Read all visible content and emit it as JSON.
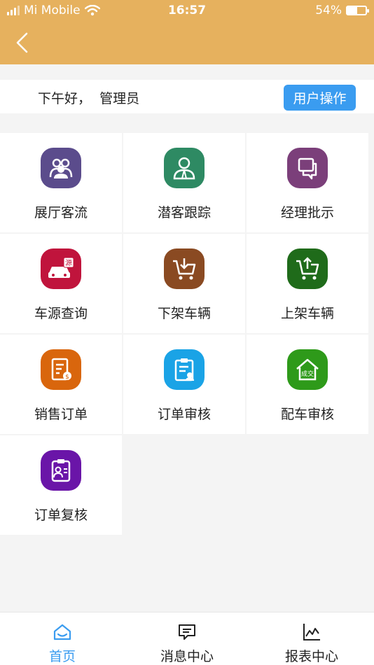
{
  "status_bar": {
    "carrier": "Mi Mobile",
    "time": "16:57",
    "battery": "54%",
    "battery_level": 0.54
  },
  "greeting": {
    "text": "下午好，  管理员",
    "action_button": "用户操作"
  },
  "menu": [
    {
      "label": "展厅客流",
      "icon": "people-group-icon",
      "color": "#5b4c8c"
    },
    {
      "label": "潜客跟踪",
      "icon": "customer-person-icon",
      "color": "#2e8a63"
    },
    {
      "label": "经理批示",
      "icon": "chat-bubbles-icon",
      "color": "#7b3f7a"
    },
    {
      "label": "车源查询",
      "icon": "car-source-icon",
      "color": "#c0143c"
    },
    {
      "label": "下架车辆",
      "icon": "cart-download-icon",
      "color": "#8a4a22"
    },
    {
      "label": "上架车辆",
      "icon": "cart-upload-icon",
      "color": "#1f6b1a"
    },
    {
      "label": "销售订单",
      "icon": "sales-order-icon",
      "color": "#d9660d"
    },
    {
      "label": "订单审核",
      "icon": "clipboard-review-icon",
      "color": "#1aa3e6"
    },
    {
      "label": "配车审核",
      "icon": "house-deal-icon",
      "color": "#2e9a1a"
    },
    {
      "label": "订单复核",
      "icon": "order-recheck-icon",
      "color": "#6a15a8"
    }
  ],
  "bottom_nav": [
    {
      "label": "首页",
      "icon": "home-icon",
      "active": true
    },
    {
      "label": "消息中心",
      "icon": "message-icon",
      "active": false
    },
    {
      "label": "报表中心",
      "icon": "chart-icon",
      "active": false
    }
  ],
  "colors": {
    "header": "#e6b15e",
    "accent": "#3a9cf0"
  }
}
